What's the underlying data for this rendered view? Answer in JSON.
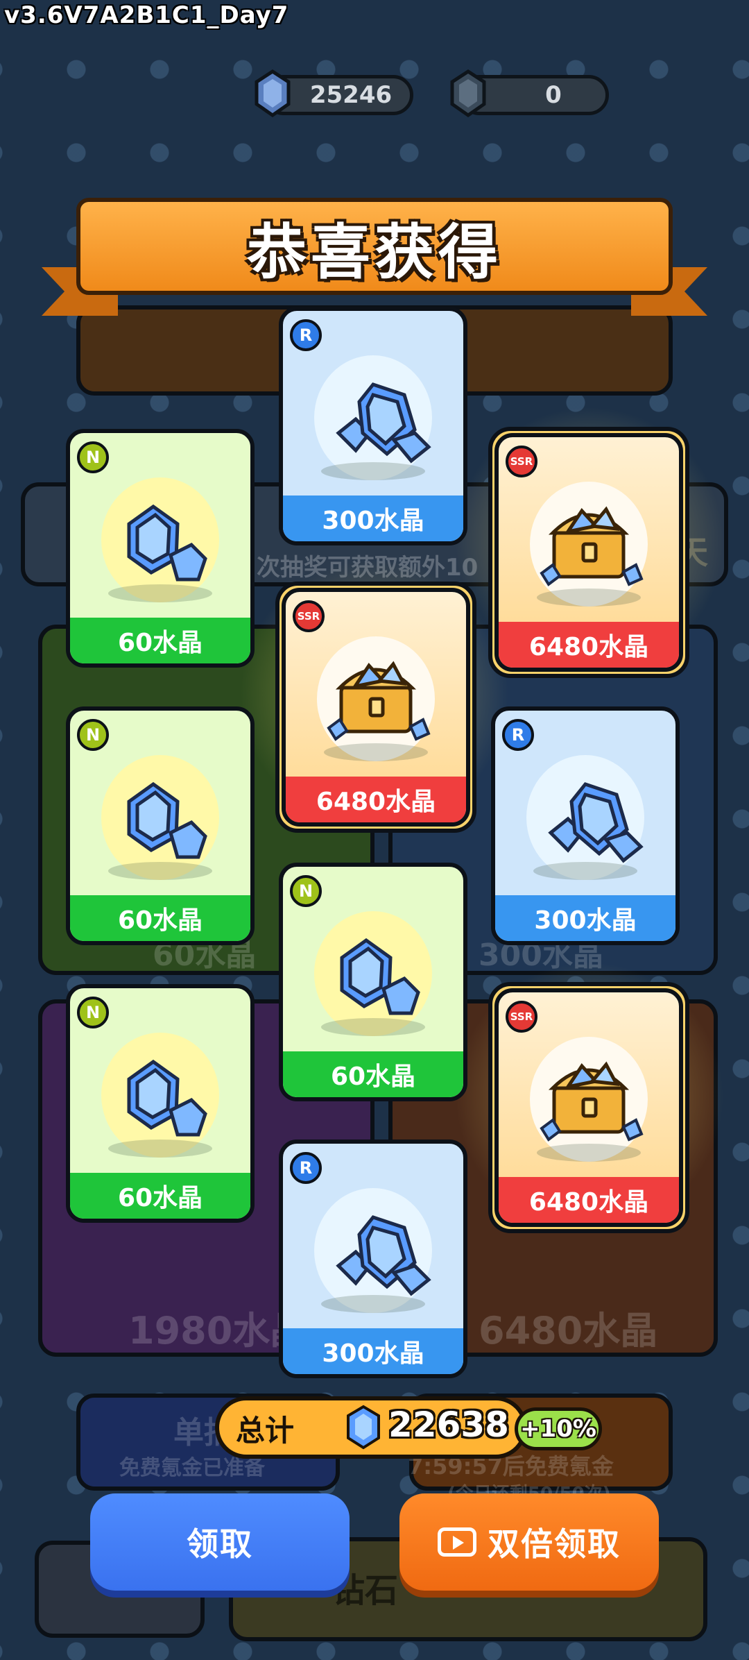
{
  "version": "v3.6V7A2B1C1_Day7",
  "currency": {
    "crystal": "25246",
    "gold_crystal": "0"
  },
  "title": "恭喜获得",
  "cards": [
    {
      "rarity": "R",
      "label": "300水晶",
      "type": "r"
    },
    {
      "rarity": "N",
      "label": "60水晶",
      "type": "n"
    },
    {
      "rarity": "SSR",
      "label": "6480水晶",
      "type": "ssr"
    },
    {
      "rarity": "SSR",
      "label": "6480水晶",
      "type": "ssr"
    },
    {
      "rarity": "N",
      "label": "60水晶",
      "type": "n"
    },
    {
      "rarity": "R",
      "label": "300水晶",
      "type": "r"
    },
    {
      "rarity": "N",
      "label": "60水晶",
      "type": "n"
    },
    {
      "rarity": "N",
      "label": "60水晶",
      "type": "n"
    },
    {
      "rarity": "SSR",
      "label": "6480水晶",
      "type": "ssr"
    },
    {
      "rarity": "R",
      "label": "300水晶",
      "type": "r"
    }
  ],
  "total": {
    "label": "总计",
    "value": "22638",
    "bonus": "+10%"
  },
  "buttons": {
    "claim": "领取",
    "double_claim": "双倍领取"
  },
  "background": {
    "subtitle": "次抽奖可获取额外10",
    "left_value": "60水晶",
    "right_value": "300水晶",
    "bottom_left_value": "1980水晶",
    "bottom_right_value": "6480水晶",
    "single_draw": "单抽",
    "single_draw_sub": "免费氪金已准备",
    "timer": "7:59:57后免费氪金",
    "remaining": "(今日还剩50/50次)",
    "diamond": "钻石",
    "day": "天"
  },
  "colors": {
    "bg": "#1d3148",
    "n": "#1fc53a",
    "r": "#3896f0",
    "ssr": "#f03e3e",
    "banner": "#f5a030"
  }
}
